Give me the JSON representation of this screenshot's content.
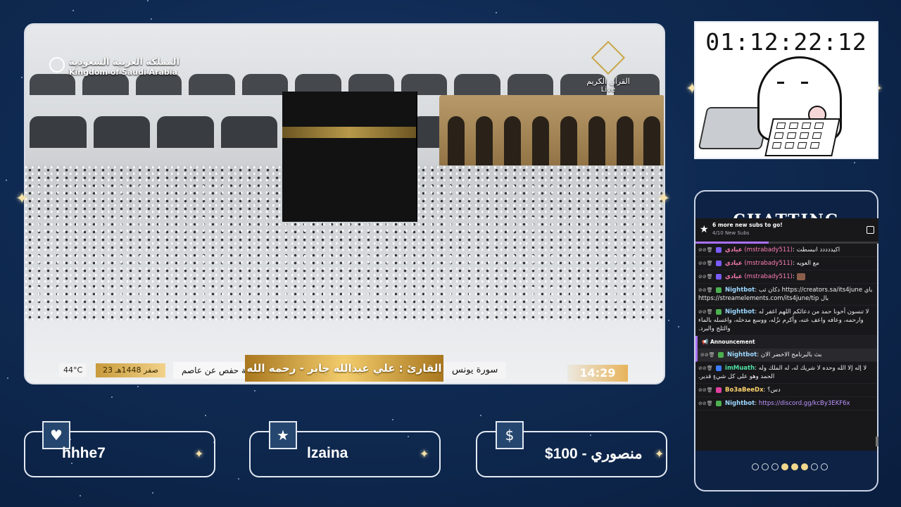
{
  "stream": {
    "brand_ar": "المملكة العربية السعودية",
    "brand_en": "Kingdom of Saudi Arabia",
    "channel_name": "القرآن الكريم",
    "live_label": "Live",
    "temperature": "44°C",
    "hijri_date": "23 صفر 1448هـ",
    "riwaya": "رواية حفص عن عاصم",
    "reader": "القارئ : علي عبدالله جابر - رحمه الله",
    "surah": "سورة يونس",
    "clock": "14:29"
  },
  "timer": {
    "value": "01:12:22:12"
  },
  "chat": {
    "title": "CHATTING",
    "goal": {
      "main": "6 more new subs to go!",
      "sub": "4/10 New Subs",
      "progress": 0.4
    },
    "messages": [
      {
        "user": "عيادي",
        "handle": "(mstrabady511)",
        "text": "اكيددددد انبسطت",
        "color": "#ff7eb6"
      },
      {
        "user": "عيادي",
        "handle": "(mstrabady511)",
        "text": "مع العويه",
        "color": "#ff7eb6"
      },
      {
        "user": "عيادي",
        "handle": "(mstrabady511)",
        "text": "",
        "color": "#ff7eb6"
      },
      {
        "user": "Nightbot",
        "handle": "",
        "text": "باي https://creators.sa/its4june دكان ثب بال https://streamelements.com/its4june/tip",
        "color": "#9cd7ff"
      },
      {
        "user": "Nightbot",
        "handle": "",
        "text": "لا تنسون أخونا حمد من دعائكم اللهم اغفر له وارحمه، وعافه واعف عنه، وأكرم نزُله، ووسع مدخله، واغسله بالماء والثلج والبرد.",
        "color": "#9cd7ff"
      }
    ],
    "announcement": {
      "label": "Announcement",
      "user": "Nightbot",
      "text": "بث بالبرنامج الاخضر الان"
    },
    "messages_after": [
      {
        "user": "imMuath",
        "handle": "",
        "text": "لا إله إلا الله وحده لا شريك له، له الملك وله الحمد وهو على كل شيءٍ قدير.",
        "color": "#4fe0a3"
      },
      {
        "user": "Bo3aBeeDx",
        "handle": "",
        "text": "دس؟",
        "color": "#ffd36e"
      },
      {
        "user": "Nightbot",
        "handle": "",
        "text": "https://discord.gg/kcBy3EKF6x",
        "color": "#9cd7ff"
      }
    ]
  },
  "alerts": [
    {
      "icon": "heart-icon",
      "glyph": "♥",
      "label": "hhhe7"
    },
    {
      "icon": "star-icon",
      "glyph": "★",
      "label": "lzaina"
    },
    {
      "icon": "dollar-icon",
      "glyph": "$",
      "label": "منصوري - 100$"
    }
  ],
  "colors": {
    "background": "#0f2a52",
    "accent_gold": "#f1d78d",
    "twitch_purple": "#a970ff"
  }
}
